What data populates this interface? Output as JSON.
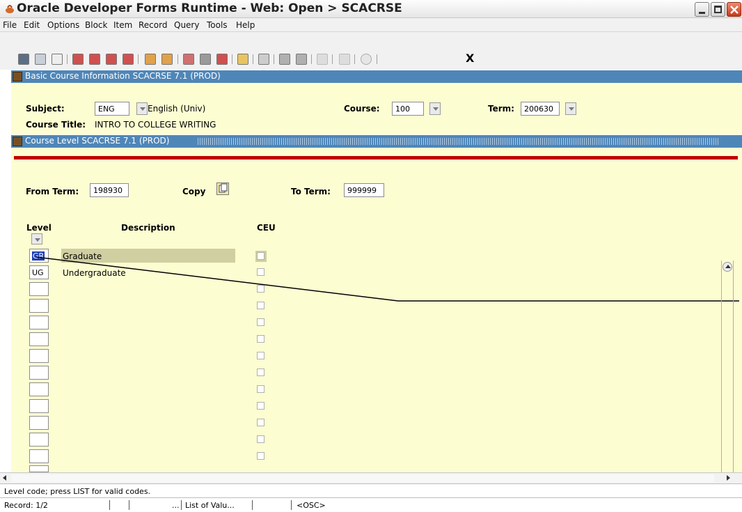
{
  "window": {
    "title": "Oracle Developer Forms Runtime - Web:  Open > SCACRSE"
  },
  "menu": [
    "File",
    "Edit",
    "Options",
    "Block",
    "Item",
    "Record",
    "Query",
    "Tools",
    "Help"
  ],
  "toolbar": {
    "exit_label": "X"
  },
  "basic": {
    "header": "Basic Course Information  SCACRSE  7.1  (PROD)",
    "subject_label": "Subject:",
    "subject_value": "ENG",
    "subject_desc": "English (Univ)",
    "course_label": "Course:",
    "course_value": "100",
    "term_label": "Term:",
    "term_value": "200630",
    "course_title_label": "Course Title:",
    "course_title_value": "INTRO TO COLLEGE WRITING"
  },
  "level": {
    "header": "Course Level  SCACRSE  7.1  (PROD)",
    "from_term_label": "From Term:",
    "from_term_value": "198930",
    "copy_label": "Copy",
    "to_term_label": "To Term:",
    "to_term_value": "999999",
    "col_level": "Level",
    "col_description": "Description",
    "col_ceu": "CEU",
    "rows": [
      {
        "code": "GR",
        "description": "Graduate"
      },
      {
        "code": "UG",
        "description": "Undergraduate"
      }
    ]
  },
  "status": {
    "hint": "Level code; press LIST for valid codes.",
    "record": "Record: 1/2",
    "ellipsis": "...",
    "list_of_values": "List of Valu...",
    "osc": "<OSC>"
  },
  "colors": {
    "header_blue": "#4f86b8",
    "panel_yellow": "#fdfdd2",
    "selected_row": "#cfcfa1",
    "red_rule": "#c00000",
    "selected_code_bg": "#1f3fb5"
  }
}
